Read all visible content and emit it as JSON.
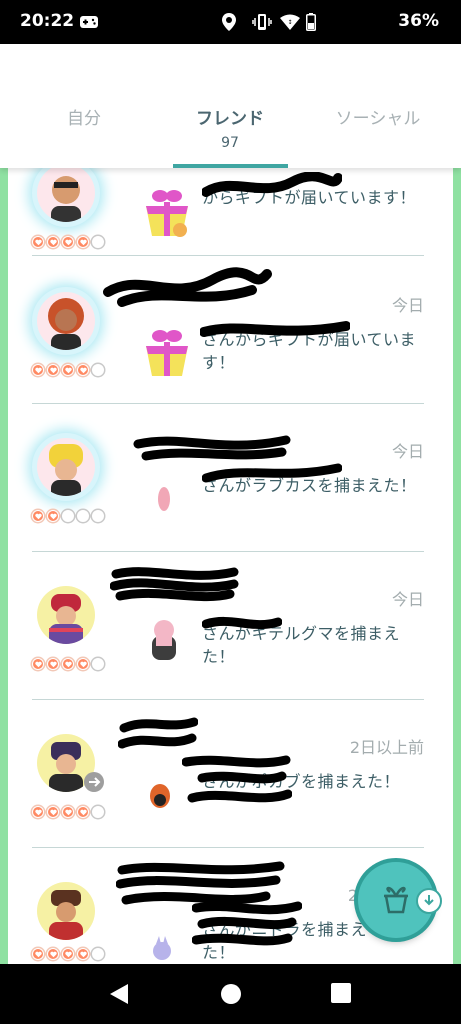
{
  "status_bar": {
    "time": "20:22",
    "battery_percent": "36%",
    "icons": [
      "gamepad-icon",
      "location-icon",
      "vibrate-icon",
      "wifi-icon",
      "battery-icon"
    ]
  },
  "tabs": [
    {
      "label": "自分",
      "active": false
    },
    {
      "label": "フレンド",
      "count": "97",
      "active": true
    },
    {
      "label": "ソーシャル",
      "active": false
    }
  ],
  "feed": [
    {
      "time": "",
      "message": "からギフトが届いています！",
      "hearts": 4,
      "icon": "gift-icon",
      "avatar_glow": true
    },
    {
      "time": "今日",
      "message": "さんからギフトが届いています！",
      "hearts": 4,
      "icon": "gift-icon",
      "avatar_glow": true
    },
    {
      "time": "今日",
      "message": "さんがラブカスを捕まえた！",
      "hearts": 2,
      "icon": "pokemon-icon",
      "avatar_glow": true
    },
    {
      "time": "今日",
      "message": "さんがキテルグマを捕まえた！",
      "hearts": 4,
      "icon": "pokemon-icon",
      "avatar_glow": false
    },
    {
      "time": "2日以上前",
      "message": "さんがポカブを捕まえた！",
      "hearts": 4,
      "icon": "pokemon-icon",
      "avatar_glow": false
    },
    {
      "time": "2日",
      "message": "さんがニドラを捕まえた！",
      "hearts": 4,
      "icon": "pokemon-icon",
      "avatar_glow": false
    }
  ],
  "fab": {
    "icon": "gift-open-icon",
    "badge_icon": "arrow-down-icon"
  },
  "colors": {
    "accent": "#3fa6a2",
    "text": "#3d5e66",
    "muted": "#a3acae",
    "heart": "#ff8a63",
    "side": "#8fe1a2"
  }
}
